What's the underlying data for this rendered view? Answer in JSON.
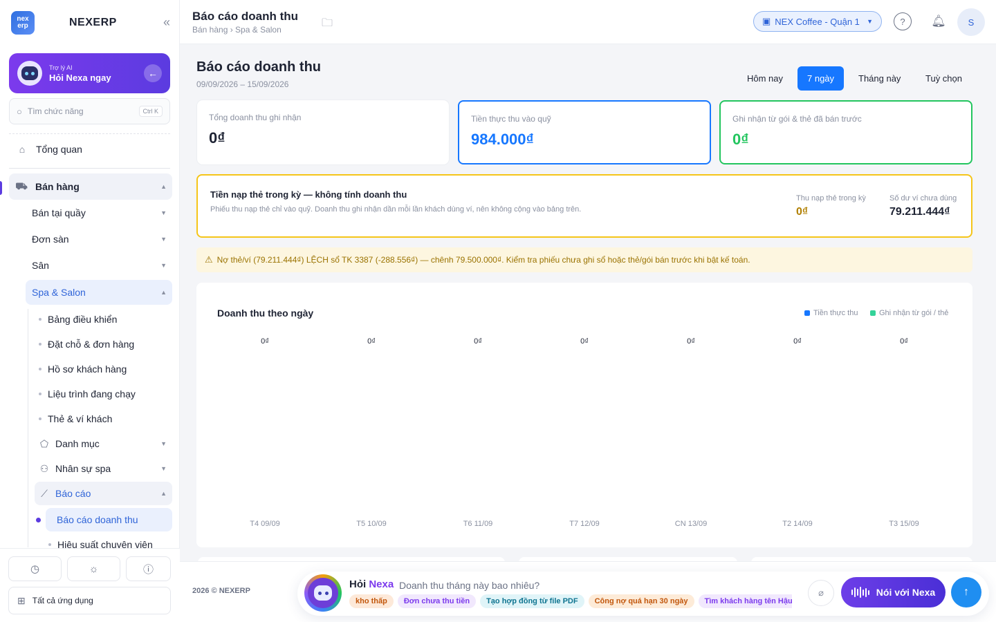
{
  "brand": {
    "name": "NEXERP",
    "logo_text_1": "nex",
    "logo_text_2": "erp"
  },
  "ai_card": {
    "sub": "Trợ lý AI",
    "main": "Hỏi Nexa ngay"
  },
  "search": {
    "placeholder": "Tìm chức năng",
    "shortcut": "Ctrl K"
  },
  "sidebar": {
    "overview": "Tổng quan",
    "sales": "Bán hàng",
    "items": [
      "Bán tại quầy",
      "Đơn sàn",
      "Sân",
      "Spa & Salon"
    ],
    "spa_items": [
      "Bảng điều khiển",
      "Đặt chỗ & đơn hàng",
      "Hồ sơ khách hàng",
      "Liệu trình đang chạy",
      "Thẻ & ví khách"
    ],
    "catalog": "Danh mục",
    "staff": "Nhân sự spa",
    "reports": "Báo cáo",
    "report_items": [
      "Báo cáo doanh thu",
      "Hiệu suất chuyên viên"
    ],
    "all_apps": "Tất cả ứng dụng"
  },
  "topbar": {
    "title": "Báo cáo doanh thu",
    "breadcrumb": "Bán hàng › Spa & Salon",
    "branch": "NEX Coffee - Quận 1",
    "avatar": "S"
  },
  "page": {
    "title": "Báo cáo doanh thu",
    "date_range": "09/09/2026 – 15/09/2026",
    "ranges": [
      "Hôm nay",
      "7 ngày",
      "Tháng này",
      "Tuỳ chọn"
    ],
    "selected_range": "7 ngày"
  },
  "kpis": [
    {
      "label": "Tổng doanh thu ghi nhận",
      "value": "0₫",
      "color": "#1e2333",
      "border": "none"
    },
    {
      "label": "Tiền thực thu vào quỹ",
      "value": "984.000₫",
      "color": "#1677ff",
      "border": "#1677ff"
    },
    {
      "label": "Ghi nhận từ gói & thẻ đã bán trước",
      "value": "0₫",
      "color": "#22c55e",
      "border": "#22c55e"
    }
  ],
  "notice": {
    "title": "Tiền nạp thẻ trong kỳ — không tính doanh thu",
    "desc": "Phiếu thu nạp thẻ chỉ vào quỹ. Doanh thu ghi nhận dần mỗi lần khách dùng ví, nên không cộng vào bảng trên.",
    "topup_label": "Thu nạp thẻ trong kỳ",
    "topup_value": "0₫",
    "balance_label": "Số dư ví chưa dùng",
    "balance_value": "79.211.444₫"
  },
  "warning": "Nợ thẻ/ví (79.211.444₫) LỆCH sổ TK 3387 (-288.556₫) — chênh 79.500.000₫. Kiểm tra phiếu chưa ghi sổ hoặc thẻ/gói bán trước khi bật kế toán.",
  "chart_data": {
    "type": "bar",
    "title": "Doanh thu theo ngày",
    "categories": [
      "T4 09/09",
      "T5 10/09",
      "T6 11/09",
      "T7 12/09",
      "CN 13/09",
      "T2 14/09",
      "T3 15/09"
    ],
    "series": [
      {
        "name": "Tiền thực thu",
        "color": "#1677ff",
        "values": [
          0,
          0,
          0,
          0,
          0,
          0,
          0
        ]
      },
      {
        "name": "Ghi nhận từ gói / thẻ",
        "color": "#34d399",
        "values": [
          0,
          0,
          0,
          0,
          0,
          0,
          0
        ]
      }
    ],
    "data_labels": [
      "0₫",
      "0₫",
      "0₫",
      "0₫",
      "0₫",
      "0₫",
      "0₫"
    ],
    "legend_position": "top-right",
    "grid": false
  },
  "footer": {
    "copyright": "2026 © NEXERP"
  },
  "ask": {
    "title_a": "Hỏi ",
    "title_b": "Nexa",
    "question": "Doanh thu tháng này bao nhiêu?",
    "chips": [
      {
        "label": "kho thấp",
        "bg": "#fde9d9",
        "fg": "#c2570c"
      },
      {
        "label": "Đơn chưa thu tiền",
        "bg": "#f1e8fd",
        "fg": "#7c3aed"
      },
      {
        "label": "Tạo hợp đồng từ file PDF",
        "bg": "#e0f4f8",
        "fg": "#0e7490"
      },
      {
        "label": "Công nợ quá hạn 30 ngày",
        "bg": "#fdebd8",
        "fg": "#c2570c"
      },
      {
        "label": "Tìm khách hàng tên Hậu",
        "bg": "#f1e8fd",
        "fg": "#7c3aed"
      }
    ],
    "voice_label": "Nói với Nexa"
  }
}
